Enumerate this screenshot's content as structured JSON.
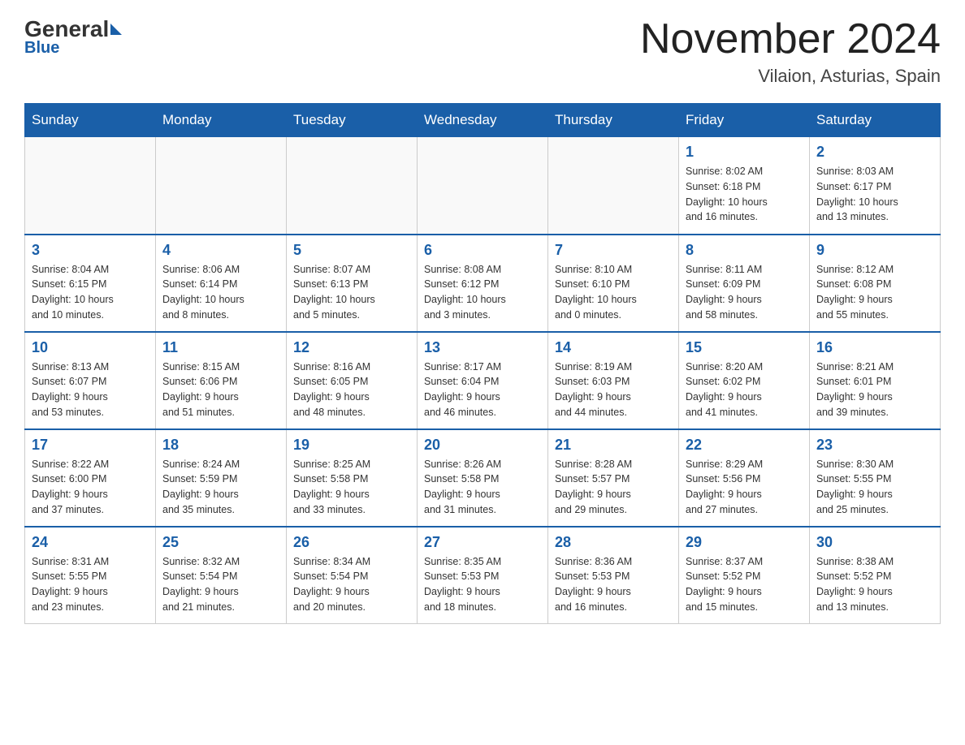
{
  "header": {
    "logo_general": "General",
    "logo_blue": "Blue",
    "month_title": "November 2024",
    "location": "Vilaion, Asturias, Spain"
  },
  "days_of_week": [
    "Sunday",
    "Monday",
    "Tuesday",
    "Wednesday",
    "Thursday",
    "Friday",
    "Saturday"
  ],
  "weeks": [
    [
      {
        "day": "",
        "info": ""
      },
      {
        "day": "",
        "info": ""
      },
      {
        "day": "",
        "info": ""
      },
      {
        "day": "",
        "info": ""
      },
      {
        "day": "",
        "info": ""
      },
      {
        "day": "1",
        "info": "Sunrise: 8:02 AM\nSunset: 6:18 PM\nDaylight: 10 hours\nand 16 minutes."
      },
      {
        "day": "2",
        "info": "Sunrise: 8:03 AM\nSunset: 6:17 PM\nDaylight: 10 hours\nand 13 minutes."
      }
    ],
    [
      {
        "day": "3",
        "info": "Sunrise: 8:04 AM\nSunset: 6:15 PM\nDaylight: 10 hours\nand 10 minutes."
      },
      {
        "day": "4",
        "info": "Sunrise: 8:06 AM\nSunset: 6:14 PM\nDaylight: 10 hours\nand 8 minutes."
      },
      {
        "day": "5",
        "info": "Sunrise: 8:07 AM\nSunset: 6:13 PM\nDaylight: 10 hours\nand 5 minutes."
      },
      {
        "day": "6",
        "info": "Sunrise: 8:08 AM\nSunset: 6:12 PM\nDaylight: 10 hours\nand 3 minutes."
      },
      {
        "day": "7",
        "info": "Sunrise: 8:10 AM\nSunset: 6:10 PM\nDaylight: 10 hours\nand 0 minutes."
      },
      {
        "day": "8",
        "info": "Sunrise: 8:11 AM\nSunset: 6:09 PM\nDaylight: 9 hours\nand 58 minutes."
      },
      {
        "day": "9",
        "info": "Sunrise: 8:12 AM\nSunset: 6:08 PM\nDaylight: 9 hours\nand 55 minutes."
      }
    ],
    [
      {
        "day": "10",
        "info": "Sunrise: 8:13 AM\nSunset: 6:07 PM\nDaylight: 9 hours\nand 53 minutes."
      },
      {
        "day": "11",
        "info": "Sunrise: 8:15 AM\nSunset: 6:06 PM\nDaylight: 9 hours\nand 51 minutes."
      },
      {
        "day": "12",
        "info": "Sunrise: 8:16 AM\nSunset: 6:05 PM\nDaylight: 9 hours\nand 48 minutes."
      },
      {
        "day": "13",
        "info": "Sunrise: 8:17 AM\nSunset: 6:04 PM\nDaylight: 9 hours\nand 46 minutes."
      },
      {
        "day": "14",
        "info": "Sunrise: 8:19 AM\nSunset: 6:03 PM\nDaylight: 9 hours\nand 44 minutes."
      },
      {
        "day": "15",
        "info": "Sunrise: 8:20 AM\nSunset: 6:02 PM\nDaylight: 9 hours\nand 41 minutes."
      },
      {
        "day": "16",
        "info": "Sunrise: 8:21 AM\nSunset: 6:01 PM\nDaylight: 9 hours\nand 39 minutes."
      }
    ],
    [
      {
        "day": "17",
        "info": "Sunrise: 8:22 AM\nSunset: 6:00 PM\nDaylight: 9 hours\nand 37 minutes."
      },
      {
        "day": "18",
        "info": "Sunrise: 8:24 AM\nSunset: 5:59 PM\nDaylight: 9 hours\nand 35 minutes."
      },
      {
        "day": "19",
        "info": "Sunrise: 8:25 AM\nSunset: 5:58 PM\nDaylight: 9 hours\nand 33 minutes."
      },
      {
        "day": "20",
        "info": "Sunrise: 8:26 AM\nSunset: 5:58 PM\nDaylight: 9 hours\nand 31 minutes."
      },
      {
        "day": "21",
        "info": "Sunrise: 8:28 AM\nSunset: 5:57 PM\nDaylight: 9 hours\nand 29 minutes."
      },
      {
        "day": "22",
        "info": "Sunrise: 8:29 AM\nSunset: 5:56 PM\nDaylight: 9 hours\nand 27 minutes."
      },
      {
        "day": "23",
        "info": "Sunrise: 8:30 AM\nSunset: 5:55 PM\nDaylight: 9 hours\nand 25 minutes."
      }
    ],
    [
      {
        "day": "24",
        "info": "Sunrise: 8:31 AM\nSunset: 5:55 PM\nDaylight: 9 hours\nand 23 minutes."
      },
      {
        "day": "25",
        "info": "Sunrise: 8:32 AM\nSunset: 5:54 PM\nDaylight: 9 hours\nand 21 minutes."
      },
      {
        "day": "26",
        "info": "Sunrise: 8:34 AM\nSunset: 5:54 PM\nDaylight: 9 hours\nand 20 minutes."
      },
      {
        "day": "27",
        "info": "Sunrise: 8:35 AM\nSunset: 5:53 PM\nDaylight: 9 hours\nand 18 minutes."
      },
      {
        "day": "28",
        "info": "Sunrise: 8:36 AM\nSunset: 5:53 PM\nDaylight: 9 hours\nand 16 minutes."
      },
      {
        "day": "29",
        "info": "Sunrise: 8:37 AM\nSunset: 5:52 PM\nDaylight: 9 hours\nand 15 minutes."
      },
      {
        "day": "30",
        "info": "Sunrise: 8:38 AM\nSunset: 5:52 PM\nDaylight: 9 hours\nand 13 minutes."
      }
    ]
  ]
}
